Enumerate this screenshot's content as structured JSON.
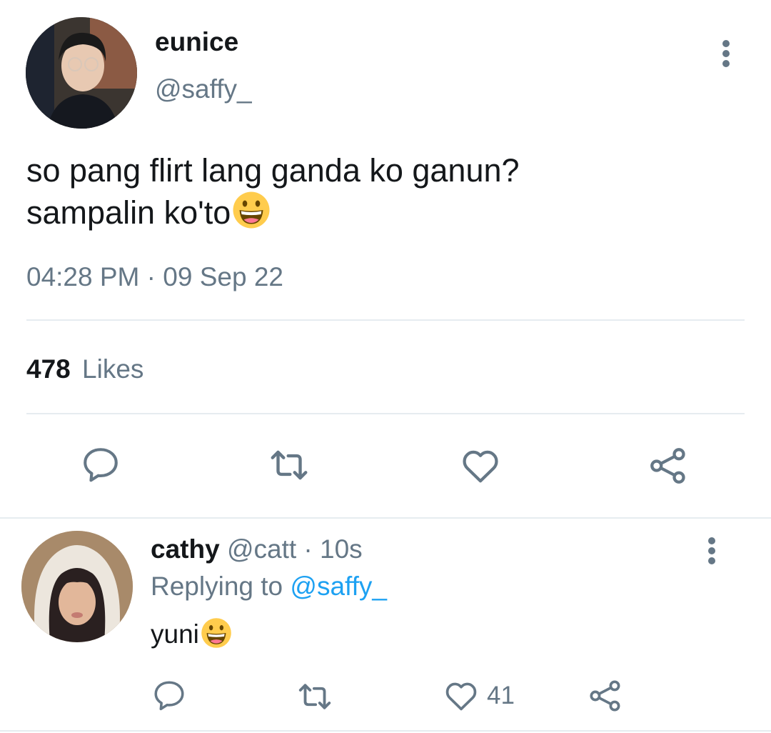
{
  "tweet": {
    "author_name": "eunice",
    "author_handle": "@saffy_",
    "text_line1": "so pang flirt lang ganda ko ganun?",
    "text_line2": "sampalin ko'to",
    "emoji": "grinning-face-emoji",
    "time": "04:28 PM",
    "separator": "·",
    "date": "09 Sep 22",
    "likes_count": "478",
    "likes_label": "Likes"
  },
  "reply": {
    "author_name": "cathy",
    "author_handle": "@catt",
    "separator": "·",
    "age": "10s",
    "replying_prefix": "Replying to",
    "replying_handle": "@saffy_",
    "text": "yuni",
    "emoji": "grinning-face-emoji",
    "like_count": "41"
  },
  "icons": {
    "comment": "comment-icon",
    "retweet": "retweet-icon",
    "like": "heart-icon",
    "share": "share-icon",
    "more": "more-vertical-icon"
  },
  "colors": {
    "text_primary": "#14171a",
    "text_secondary": "#657786",
    "link": "#1da1f2",
    "divider": "#e6ecf0",
    "emoji_yellow": "#ffcc4d"
  }
}
